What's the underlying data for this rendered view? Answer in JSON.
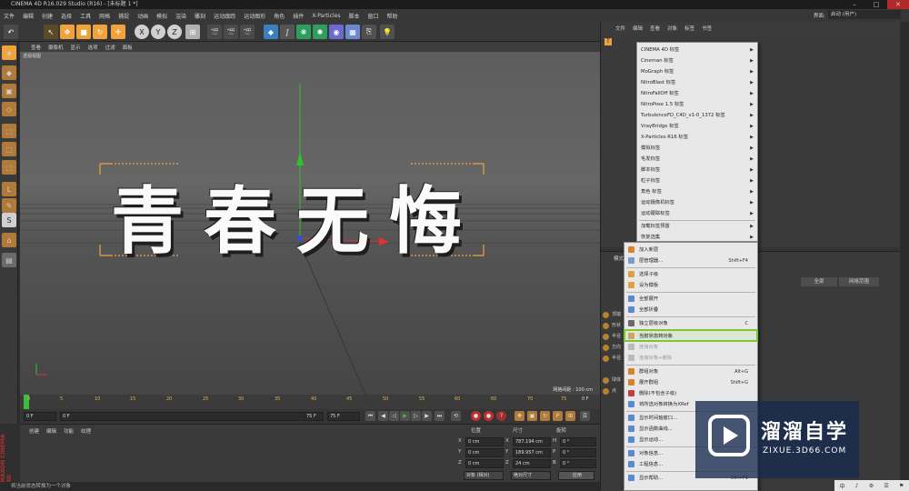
{
  "window": {
    "title": "CINEMA 4D R16.029 Studio (R16) - [未标题 1 *]",
    "min": "–",
    "max": "□",
    "close": "✕"
  },
  "menu": [
    "文件",
    "编辑",
    "创建",
    "选择",
    "工具",
    "网格",
    "捕捉",
    "动画",
    "模拟",
    "渲染",
    "雕刻",
    "运动跟踪",
    "运动图形",
    "角色",
    "插件",
    "X-Particles",
    "脚本",
    "窗口",
    "帮助"
  ],
  "viewport": {
    "menu": [
      "查看",
      "摄像机",
      "显示",
      "选项",
      "过滤",
      "面板"
    ],
    "label": "透视视图",
    "text3d": "青春无悔",
    "grid_info": "网格间距 : 100 cm"
  },
  "timeline": {
    "ticks": [
      "0",
      "5",
      "10",
      "15",
      "20",
      "25",
      "30",
      "35",
      "40",
      "45",
      "50",
      "55",
      "60",
      "65",
      "70",
      "75"
    ],
    "end_label": "0 F",
    "start_field": "0 F",
    "current_field": "0 F",
    "end_field": "75 F",
    "end_field2": "75 F"
  },
  "bottom_tabs": [
    "创建",
    "编辑",
    "功能",
    "纹理"
  ],
  "coords": {
    "headers": [
      "位置",
      "尺寸",
      "旋转"
    ],
    "rows": [
      {
        "axis": "X",
        "pos": "0 cm",
        "size": "787.194 cm",
        "rlabel": "H",
        "rot": "0 °"
      },
      {
        "axis": "Y",
        "pos": "0 cm",
        "size": "189.957 cm",
        "rlabel": "P",
        "rot": "0 °"
      },
      {
        "axis": "Z",
        "pos": "0 cm",
        "size": "24 cm",
        "rlabel": "B",
        "rot": "0 °"
      }
    ],
    "mode1": "对象 (相对)",
    "mode2": "绝对尺寸",
    "apply": "应用"
  },
  "status": "将当前状态转换为一个对象",
  "right_panel": {
    "top_menu": [
      "文件",
      "编辑",
      "查看",
      "对象",
      "标签",
      "书签"
    ],
    "layout_label": "界面:",
    "layout_value": "启动 (用户)",
    "attr_tabs": [
      "全部",
      "网格范围"
    ],
    "attr_head": "模式",
    "attr_rows": [
      "顶端",
      "形状",
      "半径",
      "方向",
      "半径",
      "球体",
      "点"
    ]
  },
  "context_menu_upper": [
    {
      "label": "CINEMA 4D 标签",
      "sub": true
    },
    {
      "label": "Cineman 标签",
      "sub": true
    },
    {
      "label": "MoGraph 标签",
      "sub": true
    },
    {
      "label": "NitroBlast 标签",
      "sub": true
    },
    {
      "label": "NitroFallOff 标签",
      "sub": true
    },
    {
      "label": "NitroPose 1.5 标签",
      "sub": true
    },
    {
      "label": "TurbulenceFD_C4D_v1-0_1372 标签",
      "sub": true
    },
    {
      "label": "VrayBridge 标签",
      "sub": true
    },
    {
      "label": "X-Particles R16 标签",
      "sub": true
    },
    {
      "label": "模拟标签",
      "sub": true
    },
    {
      "label": "毛发标签",
      "sub": true
    },
    {
      "label": "脚本标签",
      "sub": true
    },
    {
      "label": "粒子标签",
      "sub": true
    },
    {
      "label": "角色 标签",
      "sub": true
    },
    {
      "label": "运动摄像机标签",
      "sub": true
    },
    {
      "label": "运动跟踪标签",
      "sub": true
    },
    {
      "label": "加载标签预置",
      "sub": true
    },
    {
      "label": "恢复选集",
      "sub": true
    }
  ],
  "context_menu_lower": [
    {
      "label": "加入新层",
      "shortcut": "",
      "gray": false,
      "icon": "#d9822b"
    },
    {
      "label": "层管理器...",
      "shortcut": "Shift+F4",
      "gray": false,
      "icon": "#7a9ac8"
    },
    {
      "label": "选择子级",
      "shortcut": "",
      "gray": false,
      "icon": "#e0a040"
    },
    {
      "label": "设为模板",
      "shortcut": "",
      "gray": false,
      "icon": "#e0a040"
    },
    {
      "label": "全部展开",
      "shortcut": "",
      "gray": false,
      "icon": "#5a8ad0"
    },
    {
      "label": "全部折叠",
      "shortcut": "",
      "gray": false,
      "icon": "#5a8ad0"
    },
    {
      "label": "独立层级对象",
      "shortcut": "C",
      "gray": false,
      "icon": "#6a6a6a"
    },
    {
      "label": "当前状态转对象",
      "shortcut": "",
      "gray": false,
      "icon": "#d9822b"
    },
    {
      "label": "连接对象",
      "shortcut": "",
      "gray": true,
      "icon": "#aaaaaa"
    },
    {
      "label": "连接对象+删除",
      "shortcut": "",
      "gray": true,
      "icon": "#aaaaaa"
    },
    {
      "label": "群组对象",
      "shortcut": "Alt+G",
      "gray": false,
      "icon": "#d9822b"
    },
    {
      "label": "展开群组",
      "shortcut": "Shift+G",
      "gray": false,
      "icon": "#d9822b"
    },
    {
      "label": "删除(不包含子级)",
      "shortcut": "",
      "gray": false,
      "icon": "#c04040"
    },
    {
      "label": "将所选对象转换为XRef",
      "shortcut": "",
      "gray": false,
      "icon": "#5a8ad0"
    },
    {
      "label": "显示时间轴窗口...",
      "shortcut": "",
      "gray": false,
      "icon": "#5a8ad0"
    },
    {
      "label": "显示函数曲线...",
      "shortcut": "",
      "gray": false,
      "icon": "#5a8ad0"
    },
    {
      "label": "显示运动...",
      "shortcut": "",
      "gray": false,
      "icon": "#5a8ad0"
    },
    {
      "label": "对象信息...",
      "shortcut": "",
      "gray": false,
      "icon": "#5a8ad0"
    },
    {
      "label": "工程信息...",
      "shortcut": "",
      "gray": false,
      "icon": "#5a8ad0"
    },
    {
      "label": "显示帮助...",
      "shortcut": "Ctrl+F1",
      "gray": false,
      "icon": "#5a8ad0"
    }
  ],
  "watermark": {
    "title": "溜溜自学",
    "url": "ZIXUE.3D66.COM"
  },
  "taskbar": [
    "中",
    "♪",
    "⚙",
    "☰",
    "⚑"
  ],
  "colors": {
    "accent_orange": "#f0a23c",
    "highlight_green": "#7ec53a",
    "axis_red": "#e03030",
    "axis_green": "#30c030",
    "axis_blue": "#3050e0"
  }
}
